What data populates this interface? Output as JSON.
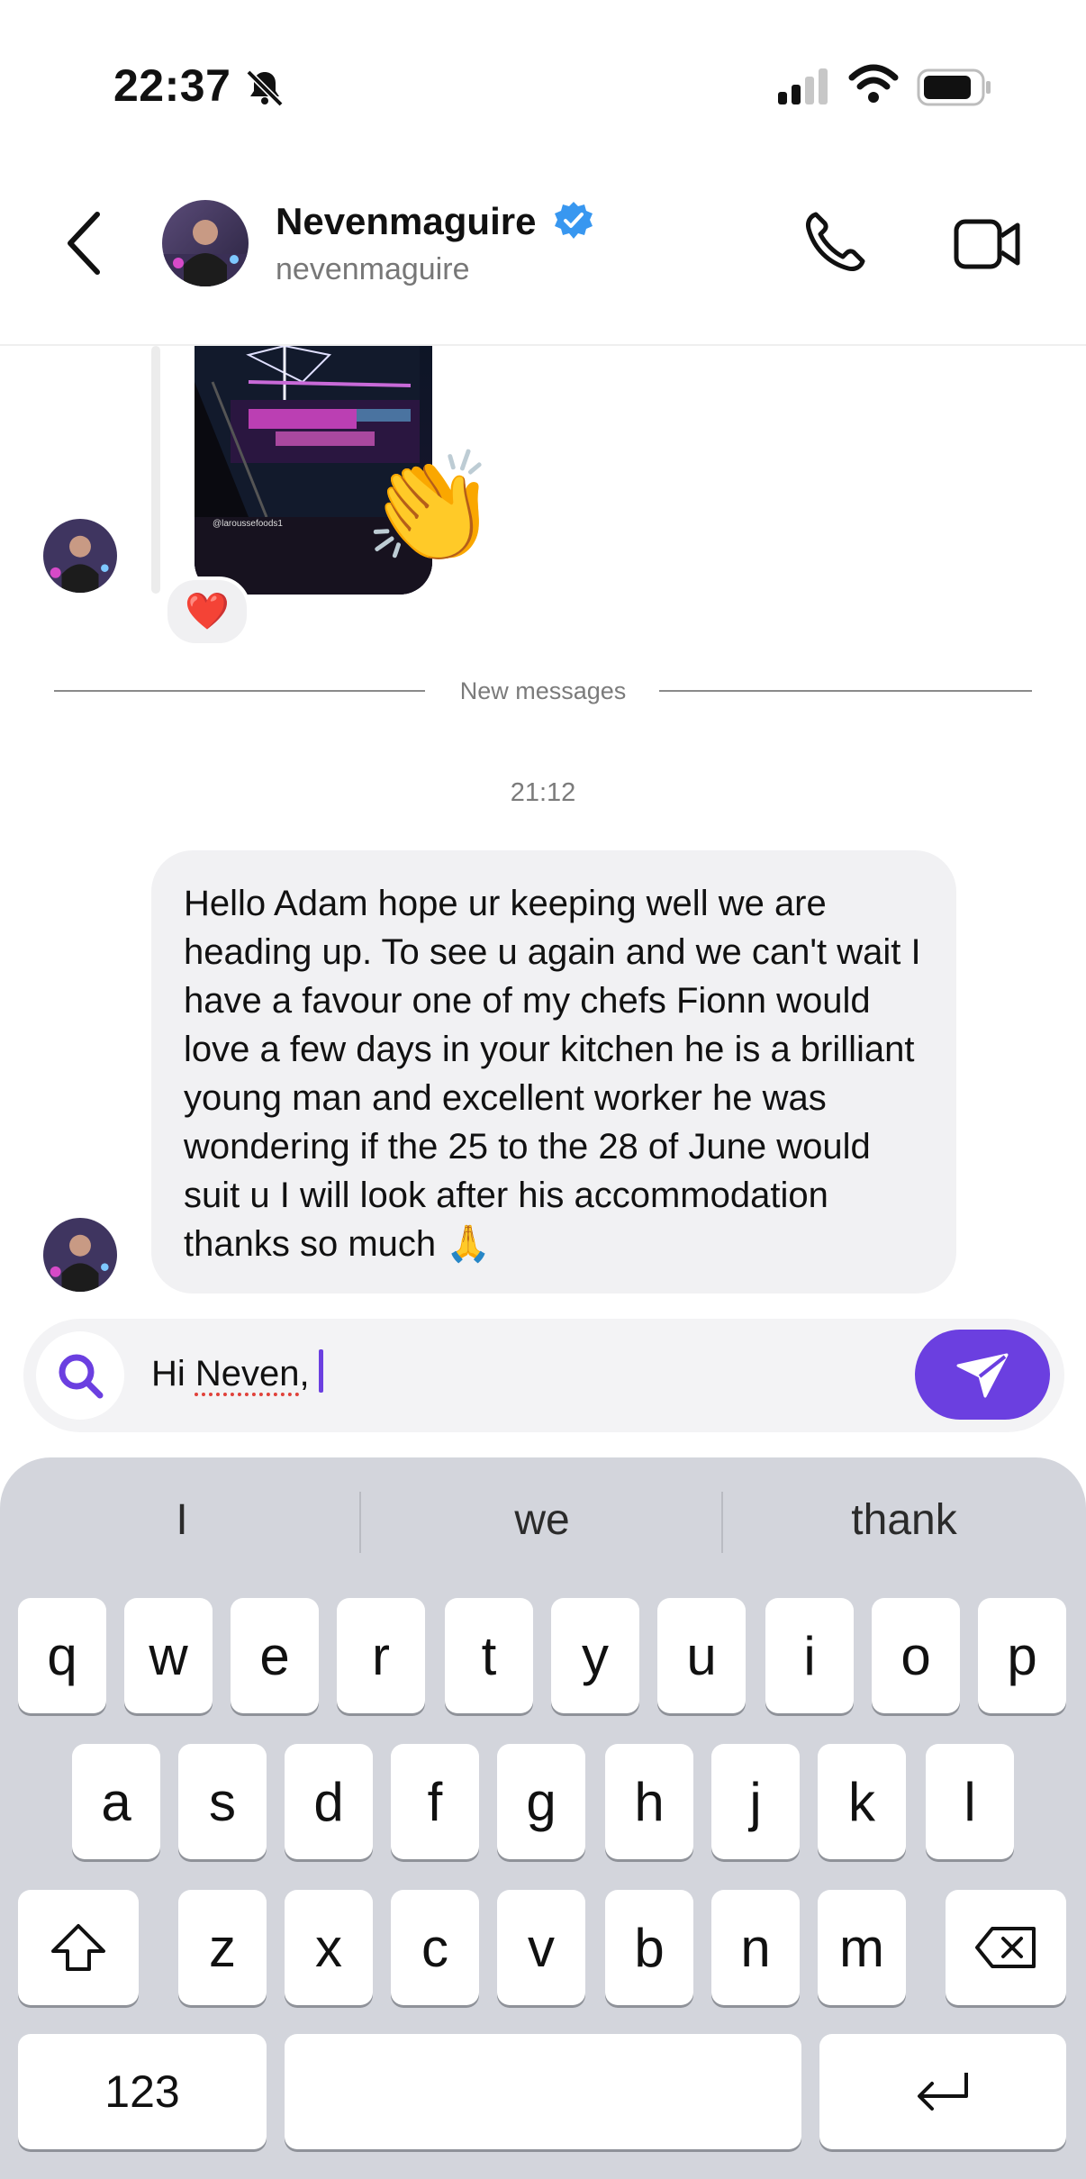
{
  "status_bar": {
    "time": "22:37"
  },
  "header": {
    "name": "Nevenmaguire",
    "handle": "nevenmaguire"
  },
  "post": {
    "credit": "@laroussefoods1",
    "reaction": "❤️",
    "sticker": "👏"
  },
  "divider": {
    "label": "New messages"
  },
  "message": {
    "time": "21:12",
    "text": "Hello Adam hope ur keeping well we are heading up. To see u again and we can't wait I have a favour one of my chefs Fionn would love a few days in your kitchen he is a brilliant young man and excellent worker he was wondering if the 25 to the 28 of June would suit u I will look after his accommodation thanks so much 🙏"
  },
  "composer": {
    "text_before": "Hi ",
    "misspelled_word": "Neven",
    "text_after": ","
  },
  "keyboard": {
    "suggestions": [
      "I",
      "we",
      "thank"
    ],
    "row1": [
      "q",
      "w",
      "e",
      "r",
      "t",
      "y",
      "u",
      "i",
      "o",
      "p"
    ],
    "row2": [
      "a",
      "s",
      "d",
      "f",
      "g",
      "h",
      "j",
      "k",
      "l"
    ],
    "row3": [
      "z",
      "x",
      "c",
      "v",
      "b",
      "n",
      "m"
    ],
    "numbers_label": "123"
  },
  "colors": {
    "accent": "#6b3fe0",
    "verified": "#3897f0",
    "bubble": "#f1f1f3",
    "keyboard_bg": "#d3d5dc"
  }
}
